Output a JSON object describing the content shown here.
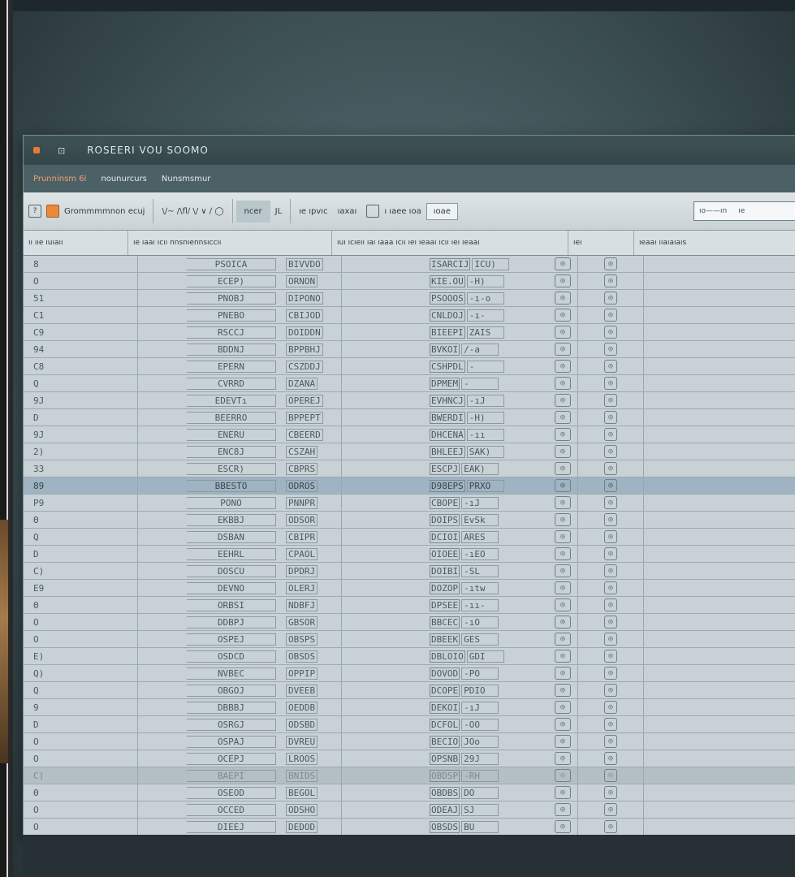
{
  "window": {
    "title": "ROSEERI VOU SOOMO",
    "icon_glyph": "⊡"
  },
  "menu": [
    "Prunninsm 6l",
    "nounurcurs",
    "Nunsmsmur"
  ],
  "toolbar": {
    "item1": "Grommmmnon ecuj",
    "item2": "\\∕∼ /\\ﬂ∕ \\/ ∨ ∕ ◯",
    "item3": "ncer",
    "item4": "JL",
    "item5": "ıe ıpvıc",
    "item6": "ıaxaı",
    "item7": "ı ıaee ıoa",
    "item8": "ıoae",
    "search_value": "ıo——ın",
    "search_suffix": "ıe"
  },
  "columns": [
    "ıı ııe ıuıaıı",
    "ıe ıaaı ıcıı nnsnıennsıccıı",
    "ıuı ıcıeıı ıaı ıaaa ıcıı ıeı ıeaaı ıcıı ıeı ıeaaı",
    "ıeı",
    "ıeaaı ııaıaıaıs"
  ],
  "rows": [
    {
      "n": "8",
      "a": "PSOICA",
      "b": "BIVVDO",
      "c": "ISARCIJ",
      "d": "ICU)",
      "s": ""
    },
    {
      "n": "O",
      "a": "ECEP)",
      "b": "ORNON",
      "c": "KIE.OU",
      "d": "-H)",
      "s": ""
    },
    {
      "n": "51",
      "a": "PNOBJ",
      "b": "DIPONO",
      "c": "PSOOOS",
      "d": "-ı-o",
      "s": ""
    },
    {
      "n": "C1",
      "a": "PNEBO",
      "b": "CBIJOD",
      "c": "CNLDOJ",
      "d": "-ı-",
      "s": ""
    },
    {
      "n": "C9",
      "a": "RSCCJ",
      "b": "DOIDDN",
      "c": "BIEEPI",
      "d": "ZAIS",
      "s": ""
    },
    {
      "n": "94",
      "a": "BDDNJ",
      "b": "BPPBHJ",
      "c": "BVKOI",
      "d": "/-a",
      "s": ""
    },
    {
      "n": "C8",
      "a": "EPERN",
      "b": "CSZDDJ",
      "c": "CSHPDL",
      "d": "-",
      "s": ""
    },
    {
      "n": "Q",
      "a": "CVRRD",
      "b": "DZANA",
      "c": "DPMEM",
      "d": "-",
      "s": ""
    },
    {
      "n": "9J",
      "a": "EDEVTı",
      "b": "OPEREJ",
      "c": "EVHNCJ",
      "d": "-ıJ",
      "s": ""
    },
    {
      "n": "D",
      "a": "BEERRO",
      "b": "BPPEPT",
      "c": "BWERDI",
      "d": "-H)",
      "s": ""
    },
    {
      "n": "9J",
      "a": "ENERU",
      "b": "CBEERD",
      "c": "DHCENA",
      "d": "-ıı",
      "s": ""
    },
    {
      "n": "2)",
      "a": "ENC8J",
      "b": "CSZAH",
      "c": "BHLEEJ",
      "d": "SAK)",
      "s": ""
    },
    {
      "n": "33",
      "a": "ESCR)",
      "b": "CBPRS",
      "c": "ESCPJ",
      "d": "EAK)",
      "s": ""
    },
    {
      "n": "89",
      "a": "BBESTO",
      "b": "ODROS",
      "c": "D98EPS",
      "d": "PRXO",
      "s": "sel"
    },
    {
      "n": "P9",
      "a": "PONO",
      "b": "PNNPR",
      "c": "CBOPE",
      "d": "-ıJ",
      "s": ""
    },
    {
      "n": "Θ",
      "a": "EKBBJ",
      "b": "ODSOR",
      "c": "DOIPS",
      "d": "EvSk",
      "s": ""
    },
    {
      "n": "Q",
      "a": "DSBAN",
      "b": "CBIPR",
      "c": "DCIOI",
      "d": "ARES",
      "s": ""
    },
    {
      "n": "D",
      "a": "EEHRL",
      "b": "CPAOL",
      "c": "OIOEE",
      "d": "-ıEO",
      "s": ""
    },
    {
      "n": "C)",
      "a": "DOSCU",
      "b": "DPDRJ",
      "c": "DOIBI",
      "d": "-SL",
      "s": ""
    },
    {
      "n": "E9",
      "a": "DEVNO",
      "b": "OLERJ",
      "c": "DOZOP",
      "d": "-ıtw",
      "s": ""
    },
    {
      "n": "Θ",
      "a": "ORBSI",
      "b": "NDBFJ",
      "c": "DPSEE",
      "d": "-ıı-",
      "s": ""
    },
    {
      "n": "O",
      "a": "DDBPJ",
      "b": "GBSOR",
      "c": "BBCEC",
      "d": "-ıO",
      "s": ""
    },
    {
      "n": "O",
      "a": "OSPEJ",
      "b": "OBSPS",
      "c": "DBEEK",
      "d": "GES",
      "s": ""
    },
    {
      "n": "E)",
      "a": "OSDCD",
      "b": "OBSDS",
      "c": "DBLOIO",
      "d": "GDI",
      "s": ""
    },
    {
      "n": "Q)",
      "a": "NVBEC",
      "b": "OPPIP",
      "c": "DOVOD",
      "d": "-PO",
      "s": ""
    },
    {
      "n": "Q",
      "a": "OBGOJ",
      "b": "DVEEB",
      "c": "DCOPE",
      "d": "PDIO",
      "s": ""
    },
    {
      "n": "9",
      "a": "DBBBJ",
      "b": "OEDDB",
      "c": "DEKOI",
      "d": "-ıJ",
      "s": ""
    },
    {
      "n": "D",
      "a": "OSRGJ",
      "b": "ODSBD",
      "c": "DCFOL",
      "d": "-OO",
      "s": ""
    },
    {
      "n": "O",
      "a": "OSPAJ",
      "b": "DVREU",
      "c": "BECIO",
      "d": "JOo",
      "s": ""
    },
    {
      "n": "O",
      "a": "OCEPJ",
      "b": "LROOS",
      "c": "OPSNB",
      "d": "29J",
      "s": ""
    },
    {
      "n": "C)",
      "a": "BAEPI",
      "b": "BNIDS",
      "c": "OBDSP",
      "d": "-RH",
      "s": "dim"
    },
    {
      "n": "Θ",
      "a": "OSEOD",
      "b": "BEGOL",
      "c": "OBDBS",
      "d": "DO",
      "s": ""
    },
    {
      "n": "O",
      "a": "OCCED",
      "b": "ODSHO",
      "c": "ODEAJ",
      "d": "SJ",
      "s": ""
    },
    {
      "n": "O",
      "a": "DIEEJ",
      "b": "DEDOD",
      "c": "OBSDS",
      "d": "BU",
      "s": ""
    }
  ]
}
